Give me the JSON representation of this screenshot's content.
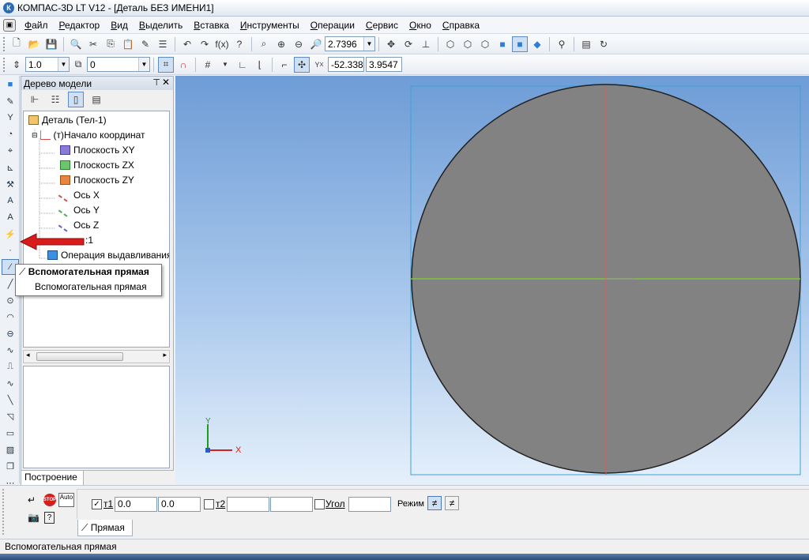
{
  "window": {
    "title": "КОМПАС-3D LT V12 - [Деталь БЕЗ ИМЕНИ1]",
    "logo": "К"
  },
  "menu": [
    "Файл",
    "Редактор",
    "Вид",
    "Выделить",
    "Вставка",
    "Инструменты",
    "Операции",
    "Сервис",
    "Окно",
    "Справка"
  ],
  "toolbar1": {
    "zoom": "2.7396"
  },
  "toolbar2": {
    "line_width": "1.0",
    "layer": "0",
    "coord_x": "-52.338",
    "coord_y": "3.9547"
  },
  "tree": {
    "title": "Дерево модели",
    "nodes": [
      {
        "label": "Деталь (Тел-1)"
      },
      {
        "label": "(т)Начало координат"
      },
      {
        "label": "Плоскость XY"
      },
      {
        "label": "Плоскость ZX"
      },
      {
        "label": "Плоскость ZY"
      },
      {
        "label": "Ось X"
      },
      {
        "label": "Ось Y"
      },
      {
        "label": "Ось Z"
      },
      {
        "label": ":1"
      },
      {
        "label": "Операция выдавливания"
      }
    ],
    "bottom_tab": "Построение"
  },
  "tooltip": {
    "title": "Вспомогательная прямая",
    "item": "Вспомогательная прямая"
  },
  "params": {
    "t1_label": "т1",
    "t1_x": "0.0",
    "t1_y": "0.0",
    "t2_label": "т2",
    "angle_label": "Угол",
    "mode_label": "Режим",
    "tab_label": "Прямая",
    "stop_label": "STOP",
    "auto_label": "Auto"
  },
  "status": {
    "text": "Вспомогательная прямая"
  },
  "axes_labels": {
    "x": "X",
    "y": "Y"
  },
  "colors": {
    "viewport_top": "#6e9cd6",
    "circle_fill": "#828282",
    "horizontal_axis": "#7cc43a",
    "vertical_axis": "#e05a5a",
    "arrow": "#d81b1b"
  },
  "icons": [
    "new-file-icon",
    "open-icon",
    "save-icon",
    "zoom-icon",
    "rotate-icon",
    "cube-view-icon",
    "grid-icon",
    "magnet-icon"
  ]
}
